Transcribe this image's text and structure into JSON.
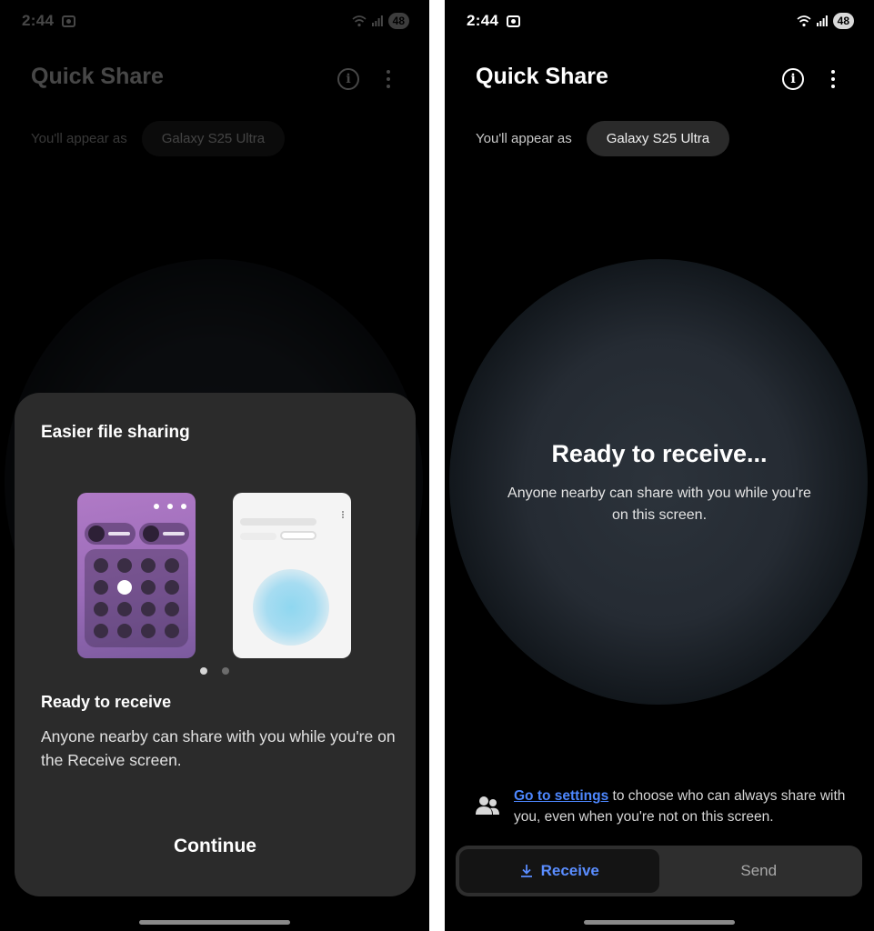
{
  "status": {
    "time": "2:44",
    "battery": "48"
  },
  "app": {
    "title": "Quick Share",
    "appear_label": "You'll appear as",
    "device_name": "Galaxy S25 Ultra"
  },
  "sheet": {
    "title": "Easier file sharing",
    "subtitle": "Ready to receive",
    "description": "Anyone nearby can share with you while you're on the Receive screen.",
    "continue_label": "Continue",
    "page_count": 2,
    "current_page": 1
  },
  "receive": {
    "title": "Ready to receive...",
    "description": "Anyone nearby can share with you while you're on this screen."
  },
  "settings_hint": {
    "link": "Go to settings",
    "rest": " to choose who can always share with you, even when you're not on this screen."
  },
  "toggle": {
    "receive_label": "Receive",
    "send_label": "Send",
    "selected": "Receive"
  },
  "colors": {
    "accent": "#4d87ff",
    "background": "#000000",
    "sheet": "#2b2b2b"
  }
}
